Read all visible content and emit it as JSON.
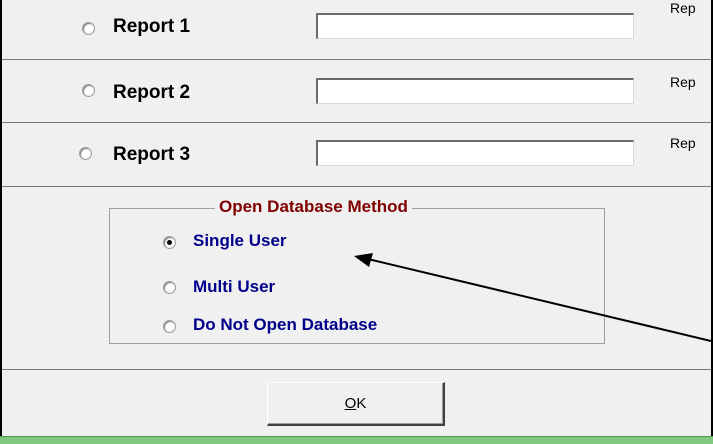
{
  "reports": [
    {
      "label": "Report 1",
      "value": "",
      "trailing_text": "Rep"
    },
    {
      "label": "Report 2",
      "value": "",
      "trailing_text": "Rep"
    },
    {
      "label": "Report 3",
      "value": "",
      "trailing_text": "Rep"
    }
  ],
  "open_database_method": {
    "title": "Open Database Method",
    "options": [
      {
        "label": "Single User",
        "selected": true
      },
      {
        "label": "Multi User",
        "selected": false
      },
      {
        "label": "Do Not Open Database",
        "selected": false
      }
    ]
  },
  "ok_button": {
    "label": "OK",
    "mnemonic": "O",
    "rest": "K"
  },
  "annotation": {
    "type": "arrow",
    "points_to": "Single User"
  },
  "colors": {
    "group_title": "#800000",
    "option_text": "#00008b",
    "dialog_background": "#f0f0f0",
    "status_strip": "#7ec97e"
  }
}
